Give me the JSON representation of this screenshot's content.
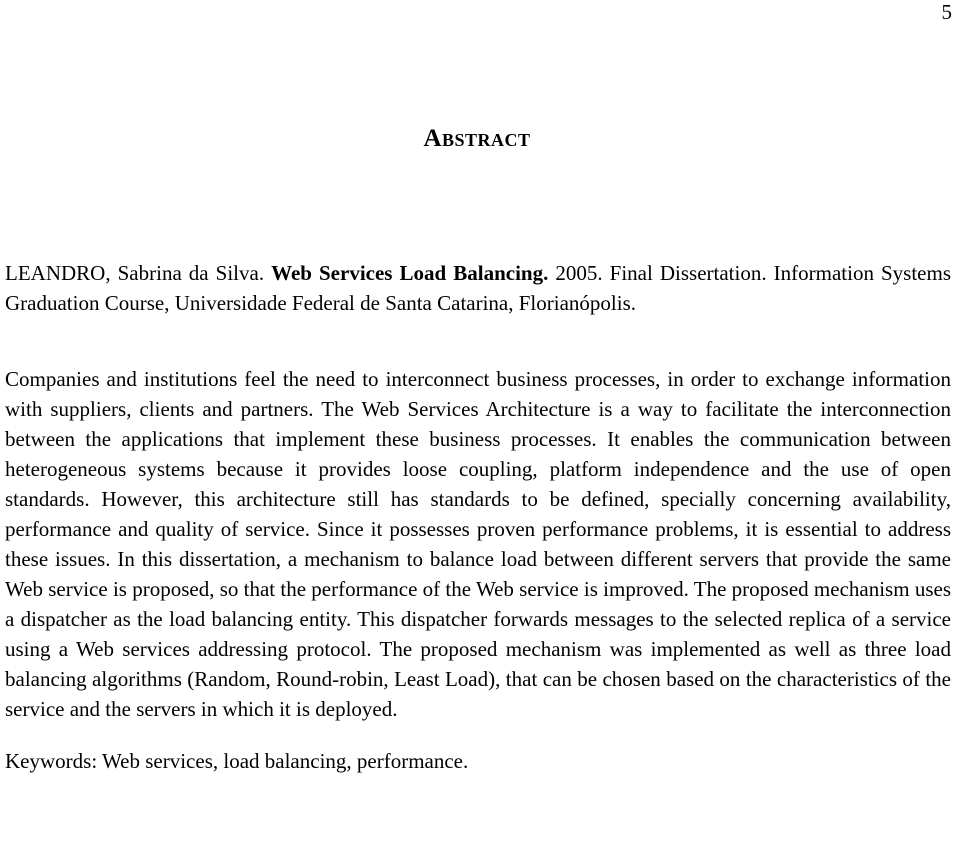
{
  "document": {
    "page_number": "5",
    "heading": "Abstract",
    "citation": {
      "author": "LEANDRO, Sabrina da Silva.",
      "title": "Web Services Load Balancing.",
      "rest": " 2005. Final Dissertation. Information Systems Graduation Course, Universidade Federal de Santa Catarina, Florianópolis."
    },
    "abstract_text": "Companies and institutions feel the need to interconnect business processes, in order to exchange information with suppliers, clients and partners. The Web Services Architecture is a way to facilitate the interconnection between the applications that implement these business processes. It enables the communication between heterogeneous systems because it provides loose coupling, platform independence and the use of open standards. However, this architecture still has standards to be defined, specially concerning availability, performance and quality of service. Since it possesses proven performance problems, it is essential to address these issues. In this dissertation, a mechanism to balance load between different servers that provide the same Web service is proposed, so that the performance of the Web service is improved. The proposed mechanism uses a dispatcher as the load balancing entity. This dispatcher forwards messages to the selected replica of a service using a Web services addressing protocol. The proposed mechanism was implemented as well as three load balancing algorithms (Random, Round-robin, Least Load), that can be chosen based on the characteristics of the service and the servers in which it is deployed.",
    "keywords_line": "Keywords: Web services, load balancing, performance."
  }
}
